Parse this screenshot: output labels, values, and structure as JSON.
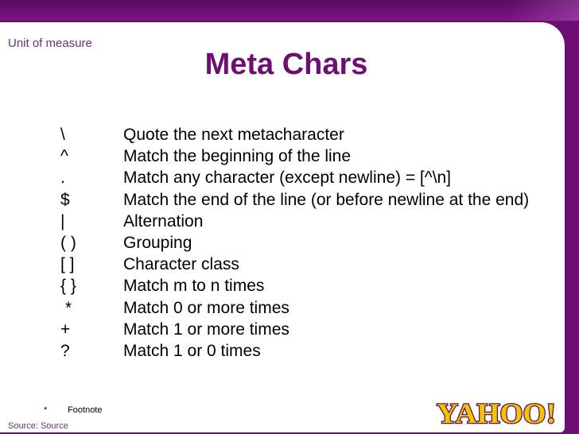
{
  "slide": {
    "unit_label": "Unit of measure",
    "title": "Meta Chars",
    "rows": [
      {
        "char": "\\",
        "desc": "Quote the next metacharacter"
      },
      {
        "char": "^",
        "desc": "Match the beginning of the line"
      },
      {
        "char": ".",
        "desc": "Match any character (except newline) = [^\\n]"
      },
      {
        "char": "$",
        "desc": "Match the end of the line (or before newline at the end)"
      },
      {
        "char": "|",
        "desc": "Alternation"
      },
      {
        "char": "( )",
        "desc": "Grouping"
      },
      {
        "char": "[ ]",
        "desc": "Character class"
      },
      {
        "char": "{ }",
        "desc": "Match m to n times"
      },
      {
        "char": "*",
        "desc": "Match 0 or more times"
      },
      {
        "char": "+",
        "desc": "Match 1 or more times"
      },
      {
        "char": "?",
        "desc": "Match 1 or 0 times"
      }
    ],
    "footnote_mark": "*",
    "footnote_text": "Footnote",
    "source": "Source: Source",
    "logo_text": "YAHOO!"
  },
  "colors": {
    "frame": "#6b0f75",
    "title": "#6b0f75",
    "logo_fill": "#f5c400",
    "logo_outline": "#5a1263"
  },
  "icons": {
    "logo": "yahoo-logo"
  }
}
